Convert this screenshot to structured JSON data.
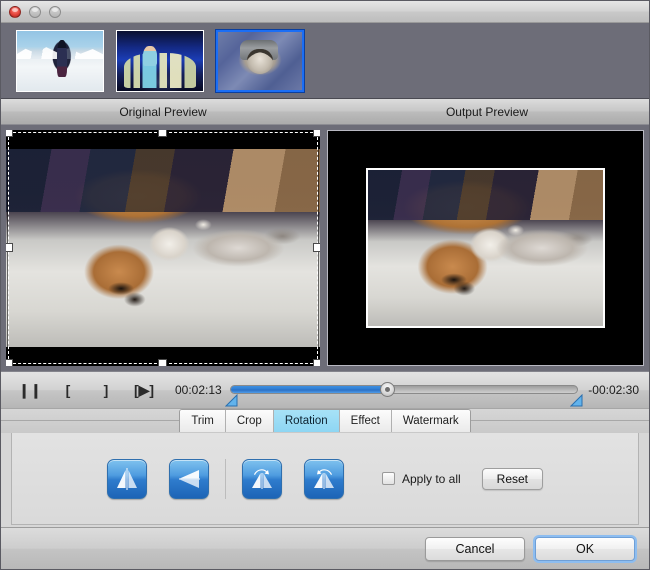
{
  "window": {
    "traffic_lights": [
      "close",
      "minimize",
      "maximize"
    ]
  },
  "thumbnails": [
    {
      "name": "skier-thumbnail",
      "selected": false
    },
    {
      "name": "stage-thumbnail",
      "selected": false
    },
    {
      "name": "kitten-thumbnail",
      "selected": true
    }
  ],
  "preview": {
    "original_label": "Original Preview",
    "output_label": "Output Preview"
  },
  "transport": {
    "pause_icon": "❙❙",
    "mark_in_icon": "[",
    "mark_out_icon": "]",
    "play_clip_icon": "[▶]",
    "current_time": "00:02:13",
    "remaining_time": "-00:02:30",
    "progress_percent": 45
  },
  "tabs": [
    {
      "label": "Trim",
      "active": false
    },
    {
      "label": "Crop",
      "active": false
    },
    {
      "label": "Rotation",
      "active": true
    },
    {
      "label": "Effect",
      "active": false
    },
    {
      "label": "Watermark",
      "active": false
    }
  ],
  "rotation_panel": {
    "buttons": [
      {
        "name": "flip-horizontal-button"
      },
      {
        "name": "flip-vertical-button"
      },
      {
        "name": "rotate-left-button"
      },
      {
        "name": "rotate-right-button"
      }
    ],
    "apply_to_all_label": "Apply to all",
    "apply_to_all_checked": false,
    "reset_label": "Reset"
  },
  "footer": {
    "cancel_label": "Cancel",
    "ok_label": "OK"
  },
  "colors": {
    "accent_blue": "#2f7ccd",
    "tab_active": "#8ed6f3",
    "strip_bg": "#6d6d78",
    "selected_thumb_border": "#1b6ef5"
  }
}
